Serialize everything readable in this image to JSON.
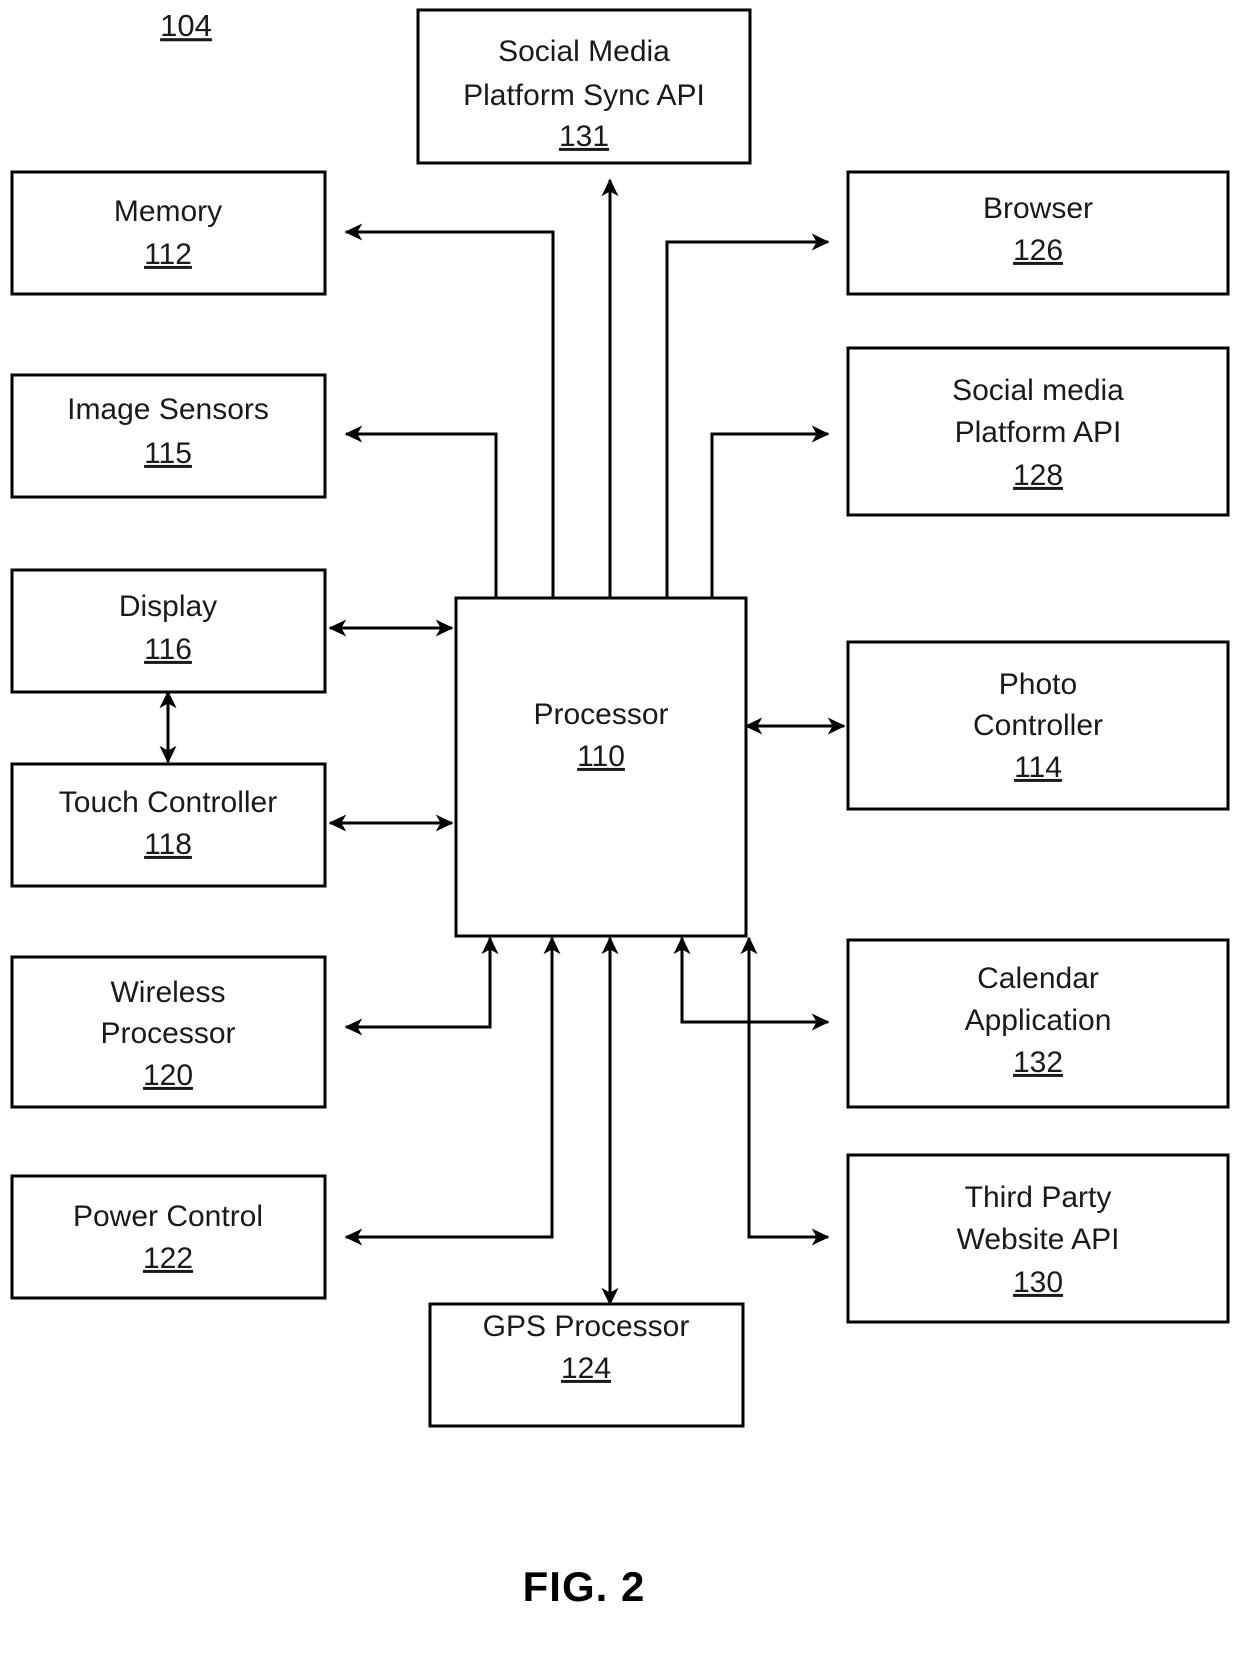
{
  "figure": {
    "caption": "FIG. 2",
    "system_ref": "104"
  },
  "nodes": {
    "social_media_sync_api": {
      "line1": "Social Media",
      "line2": "Platform Sync API",
      "ref": "131"
    },
    "memory": {
      "line1": "Memory",
      "ref": "112"
    },
    "browser": {
      "line1": "Browser",
      "ref": "126"
    },
    "image_sensors": {
      "line1": "Image Sensors",
      "ref": "115"
    },
    "social_media_platform_api": {
      "line1": "Social media",
      "line2": "Platform API",
      "ref": "128"
    },
    "display": {
      "line1": "Display",
      "ref": "116"
    },
    "processor": {
      "line1": "Processor",
      "ref": "110"
    },
    "photo_controller": {
      "line1": "Photo",
      "line2": "Controller",
      "ref": "114"
    },
    "touch_controller": {
      "line1": "Touch Controller",
      "ref": "118"
    },
    "wireless_processor": {
      "line1": "Wireless",
      "line2": "Processor",
      "ref": "120"
    },
    "calendar_application": {
      "line1": "Calendar",
      "line2": "Application",
      "ref": "132"
    },
    "power_control": {
      "line1": "Power Control",
      "ref": "122"
    },
    "third_party_website_api": {
      "line1": "Third Party",
      "line2": "Website API",
      "ref": "130"
    },
    "gps_processor": {
      "line1": "GPS Processor",
      "ref": "124"
    }
  },
  "colors": {
    "stroke": "#000000",
    "text": "#1a1a1a",
    "background": "#ffffff"
  }
}
